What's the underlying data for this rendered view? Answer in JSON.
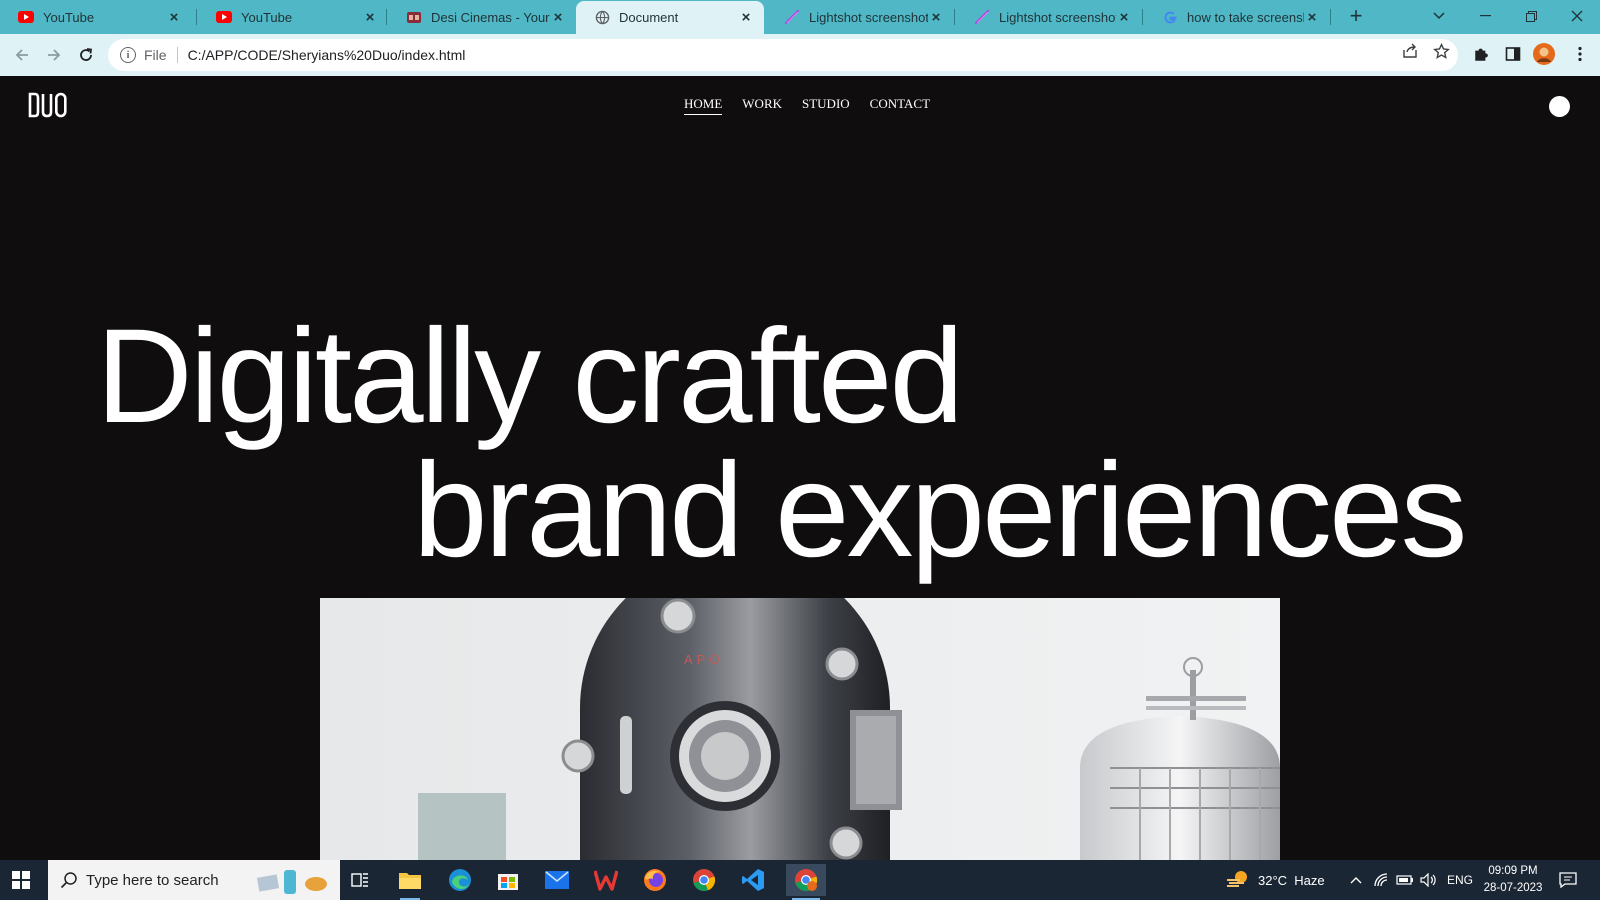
{
  "browser": {
    "tabs": [
      {
        "title": "YouTube",
        "icon": "youtube-icon"
      },
      {
        "title": "YouTube",
        "icon": "youtube-icon"
      },
      {
        "title": "Desi Cinemas - Your ho",
        "icon": "cinema-icon"
      },
      {
        "title": "Document",
        "icon": "globe-icon",
        "active": true
      },
      {
        "title": "Lightshot screenshot",
        "icon": "lightshot-icon"
      },
      {
        "title": "Lightshot screenshot",
        "icon": "lightshot-icon"
      },
      {
        "title": "how to take screenshot",
        "icon": "google-icon"
      }
    ],
    "address": {
      "scheme": "File",
      "url": "C:/APP/CODE/Sheryians%20Duo/index.html"
    },
    "colors": {
      "tabstrip": "#4fb7c5",
      "toolbar": "#dff3f6"
    }
  },
  "site": {
    "logo": "DUO",
    "nav": [
      {
        "label": "HOME",
        "current": true
      },
      {
        "label": "WORK"
      },
      {
        "label": "STUDIO"
      },
      {
        "label": "CONTACT"
      }
    ],
    "hero": {
      "line1": "Digitally crafted",
      "line2": "brand experiences"
    },
    "colors": {
      "background": "#0f0d0e",
      "text": "#ffffff"
    }
  },
  "taskbar": {
    "search_placeholder": "Type here to search",
    "weather": "32°C  Haze",
    "language": "ENG",
    "time": "09:09 PM",
    "date": "28-07-2023",
    "apps": [
      "task-view-icon",
      "file-explorer-icon",
      "edge-icon",
      "store-icon",
      "mail-icon",
      "wps-icon",
      "firefox-icon",
      "chrome-icon",
      "vscode-icon",
      "chrome-profile-icon"
    ]
  }
}
